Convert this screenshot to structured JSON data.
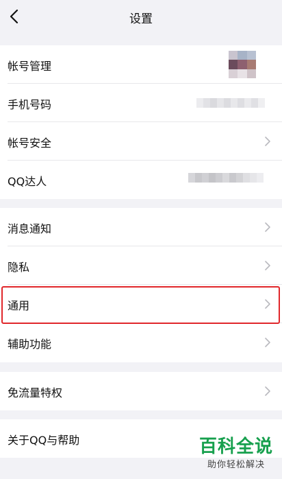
{
  "header": {
    "title": "设置"
  },
  "group1": {
    "account_mgmt": "帐号管理",
    "phone_number": "手机号码",
    "account_security": "帐号安全",
    "qq_expert": "QQ达人"
  },
  "group2": {
    "notifications": "消息通知",
    "privacy": "隐私",
    "general": "通用",
    "accessibility": "辅助功能"
  },
  "group3": {
    "free_data": "免流量特权"
  },
  "group4": {
    "about_help": "关于QQ与帮助"
  },
  "watermark": {
    "brand": "百科全说",
    "slogan": "助你轻松解决"
  },
  "colors": {
    "highlight": "#e0262a",
    "brand_green": "#17a04e"
  }
}
